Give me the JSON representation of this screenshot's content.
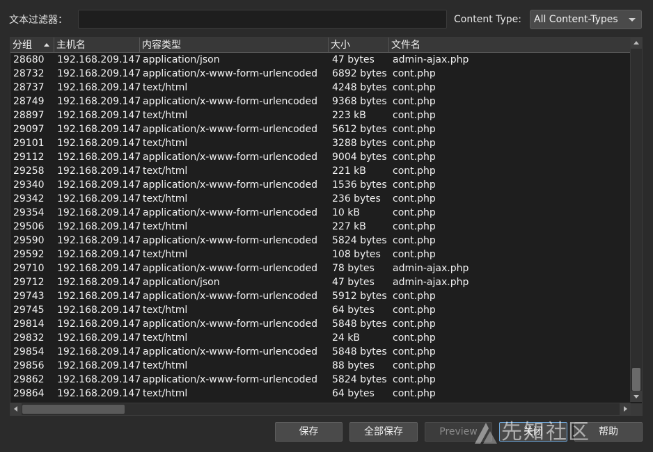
{
  "filter": {
    "label": "文本过滤器：",
    "value": ""
  },
  "content_type": {
    "label": "Content Type:",
    "selected": "All Content-Types"
  },
  "columns": [
    "分组",
    "主机名",
    "内容类型",
    "大小",
    "文件名"
  ],
  "rows": [
    [
      "28680",
      "192.168.209.147",
      "application/json",
      "47 bytes",
      "admin-ajax.php"
    ],
    [
      "28732",
      "192.168.209.147",
      "application/x-www-form-urlencoded",
      "6892 bytes",
      "cont.php"
    ],
    [
      "28737",
      "192.168.209.147",
      "text/html",
      "4248 bytes",
      "cont.php"
    ],
    [
      "28749",
      "192.168.209.147",
      "application/x-www-form-urlencoded",
      "9368 bytes",
      "cont.php"
    ],
    [
      "28897",
      "192.168.209.147",
      "text/html",
      "223 kB",
      "cont.php"
    ],
    [
      "29097",
      "192.168.209.147",
      "application/x-www-form-urlencoded",
      "5612 bytes",
      "cont.php"
    ],
    [
      "29101",
      "192.168.209.147",
      "text/html",
      "3288 bytes",
      "cont.php"
    ],
    [
      "29112",
      "192.168.209.147",
      "application/x-www-form-urlencoded",
      "9004 bytes",
      "cont.php"
    ],
    [
      "29258",
      "192.168.209.147",
      "text/html",
      "221 kB",
      "cont.php"
    ],
    [
      "29340",
      "192.168.209.147",
      "application/x-www-form-urlencoded",
      "1536 bytes",
      "cont.php"
    ],
    [
      "29342",
      "192.168.209.147",
      "text/html",
      "236 bytes",
      "cont.php"
    ],
    [
      "29354",
      "192.168.209.147",
      "application/x-www-form-urlencoded",
      "10 kB",
      "cont.php"
    ],
    [
      "29506",
      "192.168.209.147",
      "text/html",
      "227 kB",
      "cont.php"
    ],
    [
      "29590",
      "192.168.209.147",
      "application/x-www-form-urlencoded",
      "5824 bytes",
      "cont.php"
    ],
    [
      "29592",
      "192.168.209.147",
      "text/html",
      "108 bytes",
      "cont.php"
    ],
    [
      "29710",
      "192.168.209.147",
      "application/x-www-form-urlencoded",
      "78 bytes",
      "admin-ajax.php"
    ],
    [
      "29712",
      "192.168.209.147",
      "application/json",
      "47 bytes",
      "admin-ajax.php"
    ],
    [
      "29743",
      "192.168.209.147",
      "application/x-www-form-urlencoded",
      "5912 bytes",
      "cont.php"
    ],
    [
      "29745",
      "192.168.209.147",
      "text/html",
      "64 bytes",
      "cont.php"
    ],
    [
      "29814",
      "192.168.209.147",
      "application/x-www-form-urlencoded",
      "5848 bytes",
      "cont.php"
    ],
    [
      "29832",
      "192.168.209.147",
      "text/html",
      "24 kB",
      "cont.php"
    ],
    [
      "29854",
      "192.168.209.147",
      "application/x-www-form-urlencoded",
      "5848 bytes",
      "cont.php"
    ],
    [
      "29856",
      "192.168.209.147",
      "text/html",
      "88 bytes",
      "cont.php"
    ],
    [
      "29862",
      "192.168.209.147",
      "application/x-www-form-urlencoded",
      "5824 bytes",
      "cont.php"
    ],
    [
      "29864",
      "192.168.209.147",
      "text/html",
      "64 bytes",
      "cont.php"
    ]
  ],
  "sort": {
    "column": "分组",
    "direction": "ascending"
  },
  "buttons": {
    "save": "保存",
    "save_all": "全部保存",
    "preview": "Preview",
    "close": "关闭",
    "help": "帮助"
  },
  "watermark": "先知社区",
  "colors": {
    "background": "#2b2b2b",
    "table_bg": "#1e1e1e",
    "header_bg": "#383838",
    "focus_border": "#6fa6d8"
  }
}
